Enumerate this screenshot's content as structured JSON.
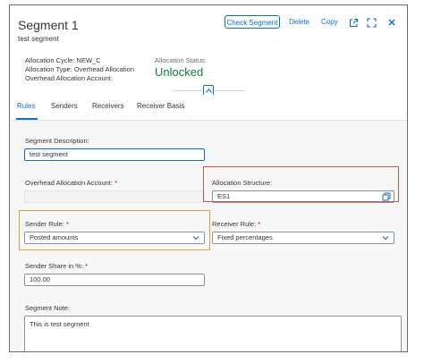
{
  "header": {
    "title": "Segment 1",
    "subtitle": "test segment",
    "check_segment_label": "Check Segment",
    "delete_label": "Delete",
    "copy_label": "Copy",
    "allocation_cycle": "Allocation Cycle: NEW_C",
    "allocation_type": "Allocation Type: Overhead Allocation",
    "overhead_allocation_account": "Overhead Allocation Account:",
    "allocation_status_label": "Allocation Status:",
    "allocation_status_value": "Unlocked",
    "status_color": "#107e3e",
    "accent_color": "#0a6ed1"
  },
  "tabs": [
    {
      "label": "Rules",
      "active": true
    },
    {
      "label": "Senders",
      "active": false
    },
    {
      "label": "Receivers",
      "active": false
    },
    {
      "label": "Receiver Basis",
      "active": false
    }
  ],
  "form": {
    "segment_description_label": "Segment Description:",
    "segment_description_value": "test segment",
    "overhead_account_label": "Overhead Allocation Account:",
    "required_mark": "*",
    "allocation_structure_label": "Allocation Structure:",
    "allocation_structure_value": "ES1",
    "sender_rule_label": "Sender Rule:",
    "sender_rule_value": "Posted amounts",
    "receiver_rule_label": "Receiver Rule:",
    "receiver_rule_value": "Fixed percentages",
    "sender_share_label": "Sender Share in %:",
    "sender_share_value": "100.00",
    "segment_note_label": "Segment Note:",
    "segment_note_value": "This is test segment"
  }
}
